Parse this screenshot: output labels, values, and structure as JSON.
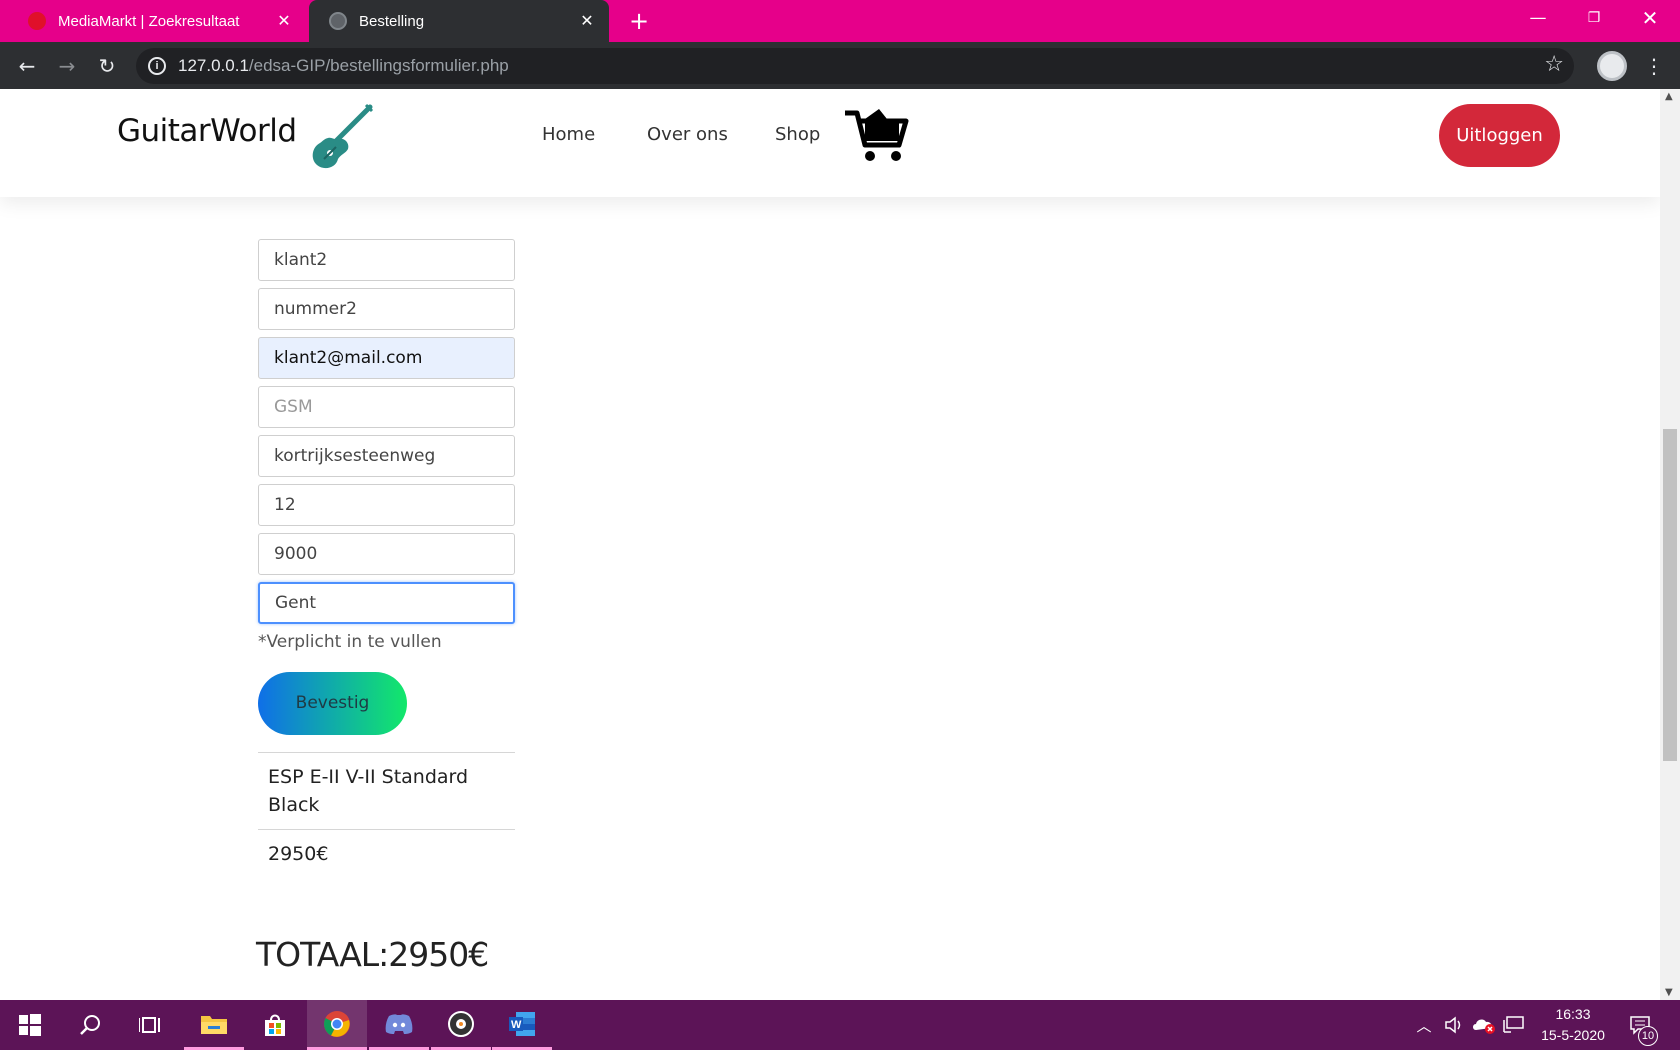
{
  "browser": {
    "tabs": [
      {
        "title": "MediaMarkt | Zoekresultaat"
      },
      {
        "title": "Bestelling"
      }
    ],
    "url_host": "127.0.0.1",
    "url_path": "/edsa-GIP/bestellingsformulier.php"
  },
  "site": {
    "logo": "GuitarWorld",
    "nav": {
      "home": "Home",
      "about": "Over ons",
      "shop": "Shop"
    },
    "logout_label": "Uitloggen"
  },
  "form": {
    "first_name": "klant2",
    "last_name": "nummer2",
    "email": "klant2@mail.com",
    "phone_placeholder": "GSM",
    "street": "kortrijksesteenweg",
    "house_number": "12",
    "postal_code": "9000",
    "city": "Gent",
    "required_note": "*Verplicht in te vullen",
    "submit_label": "Bevestig"
  },
  "order": {
    "product_name": "ESP E-II V-II Standard Black",
    "product_price": "2950€",
    "total": "TOTAAL:2950€"
  },
  "taskbar": {
    "time": "16:33",
    "date": "15-5-2020",
    "notification_count": "10"
  },
  "colors": {
    "tab_strip": "#e6008a",
    "logout_button": "#d3283a",
    "confirm_gradient_start": "#0f6fe8",
    "confirm_gradient_end": "#12e86a",
    "guitar_icon": "#2a8c86",
    "taskbar": "#5c1457"
  }
}
